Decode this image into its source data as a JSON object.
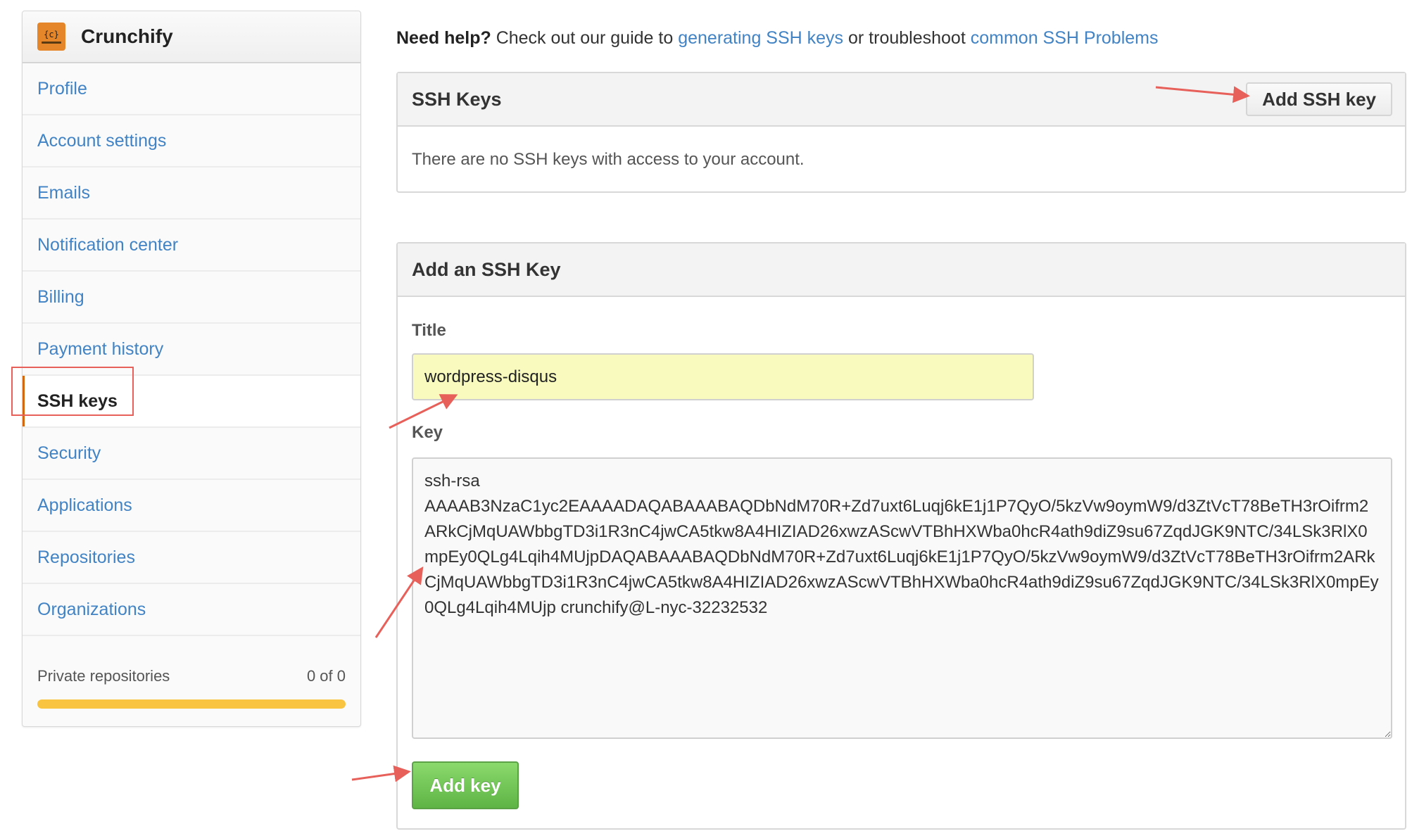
{
  "sidebar": {
    "org_name": "Crunchify",
    "logo_glyph": "{c}",
    "items": [
      {
        "label": "Profile",
        "active": false
      },
      {
        "label": "Account settings",
        "active": false
      },
      {
        "label": "Emails",
        "active": false
      },
      {
        "label": "Notification center",
        "active": false
      },
      {
        "label": "Billing",
        "active": false
      },
      {
        "label": "Payment history",
        "active": false
      },
      {
        "label": "SSH keys",
        "active": true
      },
      {
        "label": "Security",
        "active": false
      },
      {
        "label": "Applications",
        "active": false
      },
      {
        "label": "Repositories",
        "active": false
      },
      {
        "label": "Organizations",
        "active": false
      }
    ],
    "quota": {
      "label": "Private repositories",
      "value": "0 of 0",
      "used": 0,
      "total": 0
    }
  },
  "help": {
    "lead": "Need help?",
    "text1": " Check out our guide to ",
    "link1": "generating SSH keys",
    "text2": " or troubleshoot ",
    "link2": "common SSH Problems"
  },
  "ssh_keys_box": {
    "title": "SSH Keys",
    "add_button": "Add SSH key",
    "empty_message": "There are no SSH keys with access to your account."
  },
  "add_key_box": {
    "title": "Add an SSH Key",
    "title_label": "Title",
    "title_value": "wordpress-disqus",
    "key_label": "Key",
    "key_value": "ssh-rsa\nAAAAB3NzaC1yc2EAAAADAQABAAABAQDbNdM70R+Zd7uxt6Luqj6kE1j1P7QyO/5kzVw9oymW9/d3ZtVcT78BeTH3rOifrm2ARkCjMqUAWbbgTD3i1R3nC4jwCA5tkw8A4HIZIAD26xwzAScwVTBhHXWba0hcR4ath9diZ9su67ZqdJGK9NTC/34LSk3RlX0mpEy0QLg4Lqih4MUjpDAQABAAABAQDbNdM70R+Zd7uxt6Luqj6kE1j1P7QyO/5kzVw9oymW9/d3ZtVcT78BeTH3rOifrm2ARkCjMqUAWbbgTD3i1R3nC4jwCA5tkw8A4HIZIAD26xwzAScwVTBhHXWba0hcR4ath9diZ9su67ZqdJGK9NTC/34LSk3RlX0mpEy0QLg4Lqih4MUjp crunchify@L-nyc-32232532",
    "submit_button": "Add key"
  },
  "colors": {
    "link": "#4183c4",
    "active_indicator": "#d26911",
    "annotation": "#e8605a",
    "quota_bar": "#f9c440",
    "submit_green": "#6cc04a",
    "title_input_bg": "#f8fbbd"
  }
}
